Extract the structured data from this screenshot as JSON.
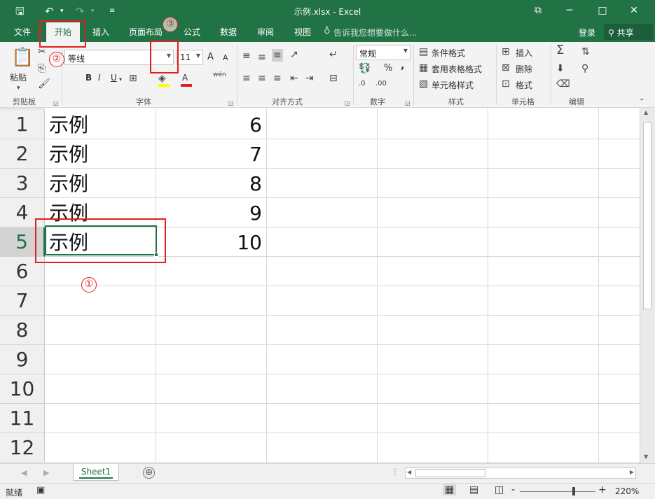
{
  "window": {
    "title": "示例.xlsx - Excel",
    "save_icon": "save-icon",
    "undo_icon": "undo-icon",
    "redo_icon": "redo-icon",
    "ribbon_display_icon": "ribbon-display-icon",
    "minimize": "─",
    "maximize": "□",
    "close": "✕"
  },
  "tabs": [
    {
      "label": "文件"
    },
    {
      "label": "开始",
      "active": true
    },
    {
      "label": "插入"
    },
    {
      "label": "页面布局"
    },
    {
      "label": "公式"
    },
    {
      "label": "数据"
    },
    {
      "label": "审阅"
    },
    {
      "label": "视图"
    }
  ],
  "tell_me": "告诉我您想要做什么...",
  "login": "登录",
  "share": "共享",
  "ribbon": {
    "clipboard": {
      "label": "剪贴板",
      "paste": "粘贴"
    },
    "font": {
      "label": "字体",
      "font_name": "等线",
      "font_size": "11",
      "bold": "B",
      "italic": "I",
      "underline": "U",
      "increase": "A",
      "decrease": "A",
      "phonetic": "wén"
    },
    "alignment": {
      "label": "对齐方式"
    },
    "number": {
      "label": "数字",
      "format": "常规",
      "percent": "%",
      "comma": ","
    },
    "styles": {
      "label": "样式",
      "conditional": "条件格式",
      "table": "套用表格格式",
      "cell_styles": "单元格样式"
    },
    "cells": {
      "label": "单元格",
      "insert": "插入",
      "delete": "删除",
      "format": "格式"
    },
    "editing": {
      "label": "编辑"
    }
  },
  "grid": {
    "row_headers": [
      "1",
      "2",
      "3",
      "4",
      "5",
      "6",
      "7",
      "8",
      "9",
      "10",
      "11",
      "12"
    ],
    "selected_row": "5",
    "rows": [
      {
        "a": "示例",
        "b": "6"
      },
      {
        "a": "示例",
        "b": "7"
      },
      {
        "a": "示例",
        "b": "8"
      },
      {
        "a": "示例",
        "b": "9"
      },
      {
        "a": "示例",
        "b": "10"
      }
    ]
  },
  "annotations": [
    "①",
    "②",
    "③"
  ],
  "sheets": [
    {
      "label": "Sheet1"
    }
  ],
  "add_sheet": "⊕",
  "status": {
    "ready": "就绪",
    "zoom_out": "-",
    "zoom_in": "+",
    "zoom": "220%"
  },
  "colors": {
    "accent": "#217346",
    "annotation": "#e02020"
  }
}
